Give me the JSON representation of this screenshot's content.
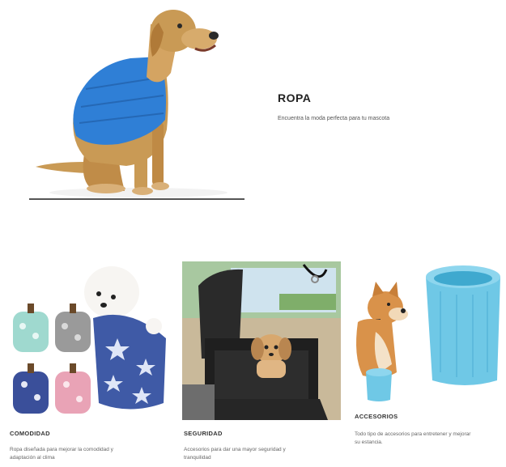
{
  "hero": {
    "title": "ROPA",
    "description": "Encuentra la moda perfecta para tu mascota",
    "image_alt": "golden retriever in blue puffer vest"
  },
  "cards": [
    {
      "title": "COMODIDAD",
      "description_line1": "Ropa diseñada para mejorar la comodidad y",
      "description_line2": "adaptación al clima"
    },
    {
      "title": "SEGURIDAD",
      "description_line1": "Accesorios para dar una mayor seguridad y",
      "description_line2": "tranquilidad"
    },
    {
      "title": "ACCESORIOS",
      "description_line1": "Todo tipo de accesorios para entretener y mejorar",
      "description_line2": "su estancia."
    }
  ],
  "colors": {
    "background": "#ffffff",
    "vest_blue": "#2f7fd6",
    "cup_blue": "#6fc8e6",
    "golden_fur": "#c99a55"
  }
}
